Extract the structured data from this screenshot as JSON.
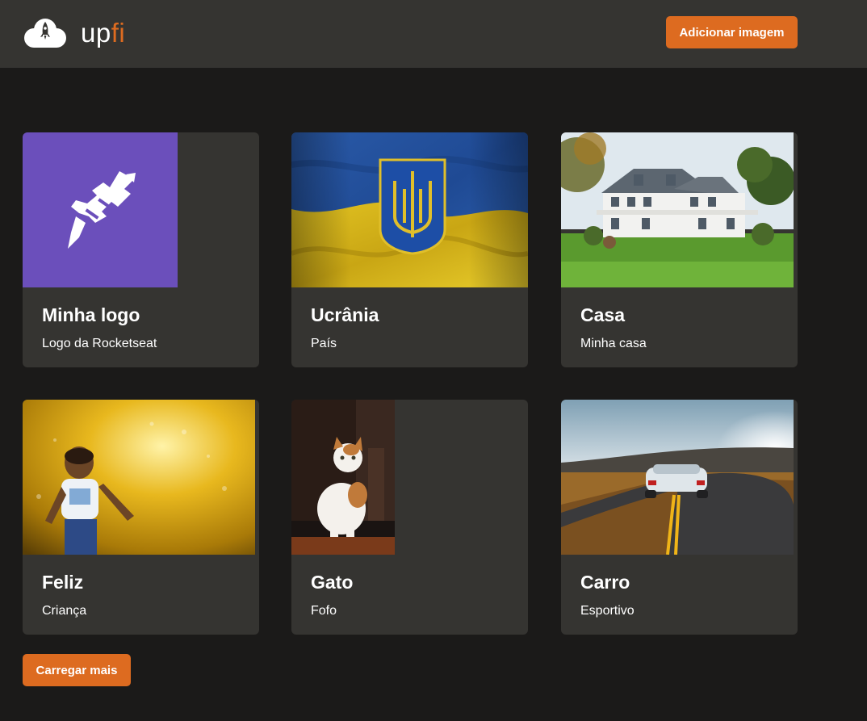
{
  "header": {
    "logo_up": "up",
    "logo_fi": "fi",
    "add_button_label": "Adicionar imagem"
  },
  "cards": [
    {
      "title": "Minha logo",
      "description": "Logo da Rocketseat",
      "image": "rocketseat-logo"
    },
    {
      "title": "Ucrânia",
      "description": "País",
      "image": "ukraine-flag"
    },
    {
      "title": "Casa",
      "description": "Minha casa",
      "image": "house-photo"
    },
    {
      "title": "Feliz",
      "description": "Criança",
      "image": "child-photo"
    },
    {
      "title": "Gato",
      "description": "Fofo",
      "image": "cat-photo"
    },
    {
      "title": "Carro",
      "description": "Esportivo",
      "image": "car-photo"
    }
  ],
  "load_more_label": "Carregar mais",
  "colors": {
    "accent": "#dd6b20",
    "background": "#1b1a19",
    "surface": "#353431",
    "logo_purple": "#6b4fbb"
  }
}
